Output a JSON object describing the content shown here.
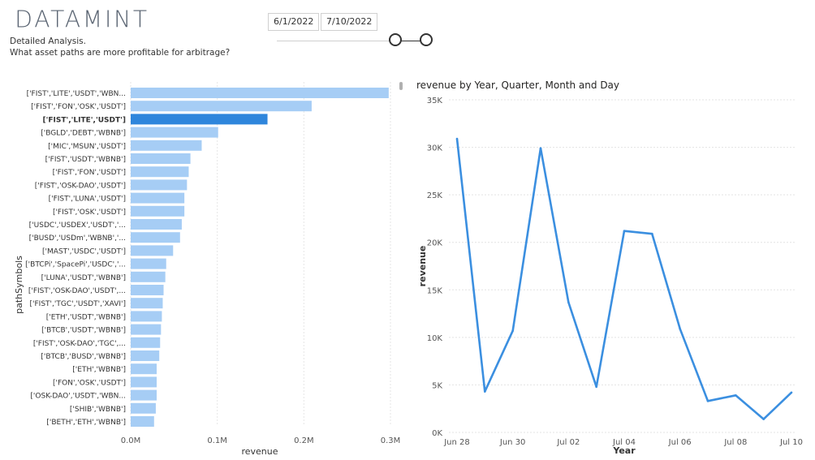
{
  "header": {
    "logo_text": "DATAMINT",
    "subtitle_line1": "Detailed Analysis.",
    "subtitle_line2": "What asset paths are more profitable for arbitrage?"
  },
  "date_filter": {
    "start": "6/1/2022",
    "end": "7/10/2022"
  },
  "colors": {
    "bar": "#a6cdf5",
    "bar_selected": "#2f86dc",
    "line": "#3b8fe0",
    "logo_dark": "#5a6472"
  },
  "chart_data": [
    {
      "type": "bar",
      "orientation": "horizontal",
      "xlabel": "revenue",
      "ylabel": "pathSymbols",
      "xlim": [
        0,
        0.3
      ],
      "x_ticks": [
        "0.0M",
        "0.1M",
        "0.2M",
        "0.3M"
      ],
      "x_tick_values": [
        0,
        0.1,
        0.2,
        0.3
      ],
      "selected_index": 2,
      "categories": [
        "['FIST','LITE','USDT','WBN...",
        "['FIST','FON','OSK','USDT']",
        "['FIST','LITE','USDT']",
        "['BGLD','DEBT','WBNB']",
        "['MIC','MSUN','USDT']",
        "['FIST','USDT','WBNB']",
        "['FIST','FON','USDT']",
        "['FIST','OSK-DAO','USDT']",
        "['FIST','LUNA','USDT']",
        "['FIST','OSK','USDT']",
        "['USDC','USDEX','USDT','...",
        "['BUSD','USDm','WBNB','...",
        "['MAST','USDC','USDT']",
        "['BTCPi','SpacePi','USDC','...",
        "['LUNA','USDT','WBNB']",
        "['FIST','OSK-DAO','USDT',...",
        "['FIST','TGC','USDT','XAVI']",
        "['ETH','USDT','WBNB']",
        "['BTCB','USDT','WBNB']",
        "['FIST','OSK-DAO','TGC',...",
        "['BTCB','BUSD','WBNB']",
        "['ETH','WBNB']",
        "['FON','OSK','USDT']",
        "['OSK-DAO','USDT','WBN...",
        "['SHIB','WBNB']",
        "['BETH','ETH','WBNB']"
      ],
      "values": [
        0.298,
        0.209,
        0.158,
        0.101,
        0.082,
        0.069,
        0.067,
        0.065,
        0.062,
        0.062,
        0.059,
        0.057,
        0.049,
        0.041,
        0.04,
        0.038,
        0.037,
        0.036,
        0.035,
        0.034,
        0.033,
        0.03,
        0.03,
        0.03,
        0.029,
        0.027
      ]
    },
    {
      "type": "line",
      "title": "revenue by Year, Quarter, Month and Day",
      "xlabel": "Year",
      "ylabel": "revenue",
      "ylim": [
        0,
        35000
      ],
      "y_ticks": [
        "0K",
        "5K",
        "10K",
        "15K",
        "20K",
        "25K",
        "30K",
        "35K"
      ],
      "y_tick_values": [
        0,
        5000,
        10000,
        15000,
        20000,
        25000,
        30000,
        35000
      ],
      "x_ticks": [
        "Jun 28",
        "Jun 30",
        "Jul 02",
        "Jul 04",
        "Jul 06",
        "Jul 08",
        "Jul 10"
      ],
      "x_dates": [
        "Jun 28",
        "Jun 29",
        "Jun 30",
        "Jul 01",
        "Jul 02",
        "Jul 03",
        "Jul 04",
        "Jul 05",
        "Jul 06",
        "Jul 07",
        "Jul 08",
        "Jul 09",
        "Jul 10"
      ],
      "values": [
        30900,
        4300,
        10700,
        29900,
        13700,
        4800,
        21200,
        20900,
        10900,
        3300,
        3900,
        1400,
        4200
      ]
    }
  ]
}
